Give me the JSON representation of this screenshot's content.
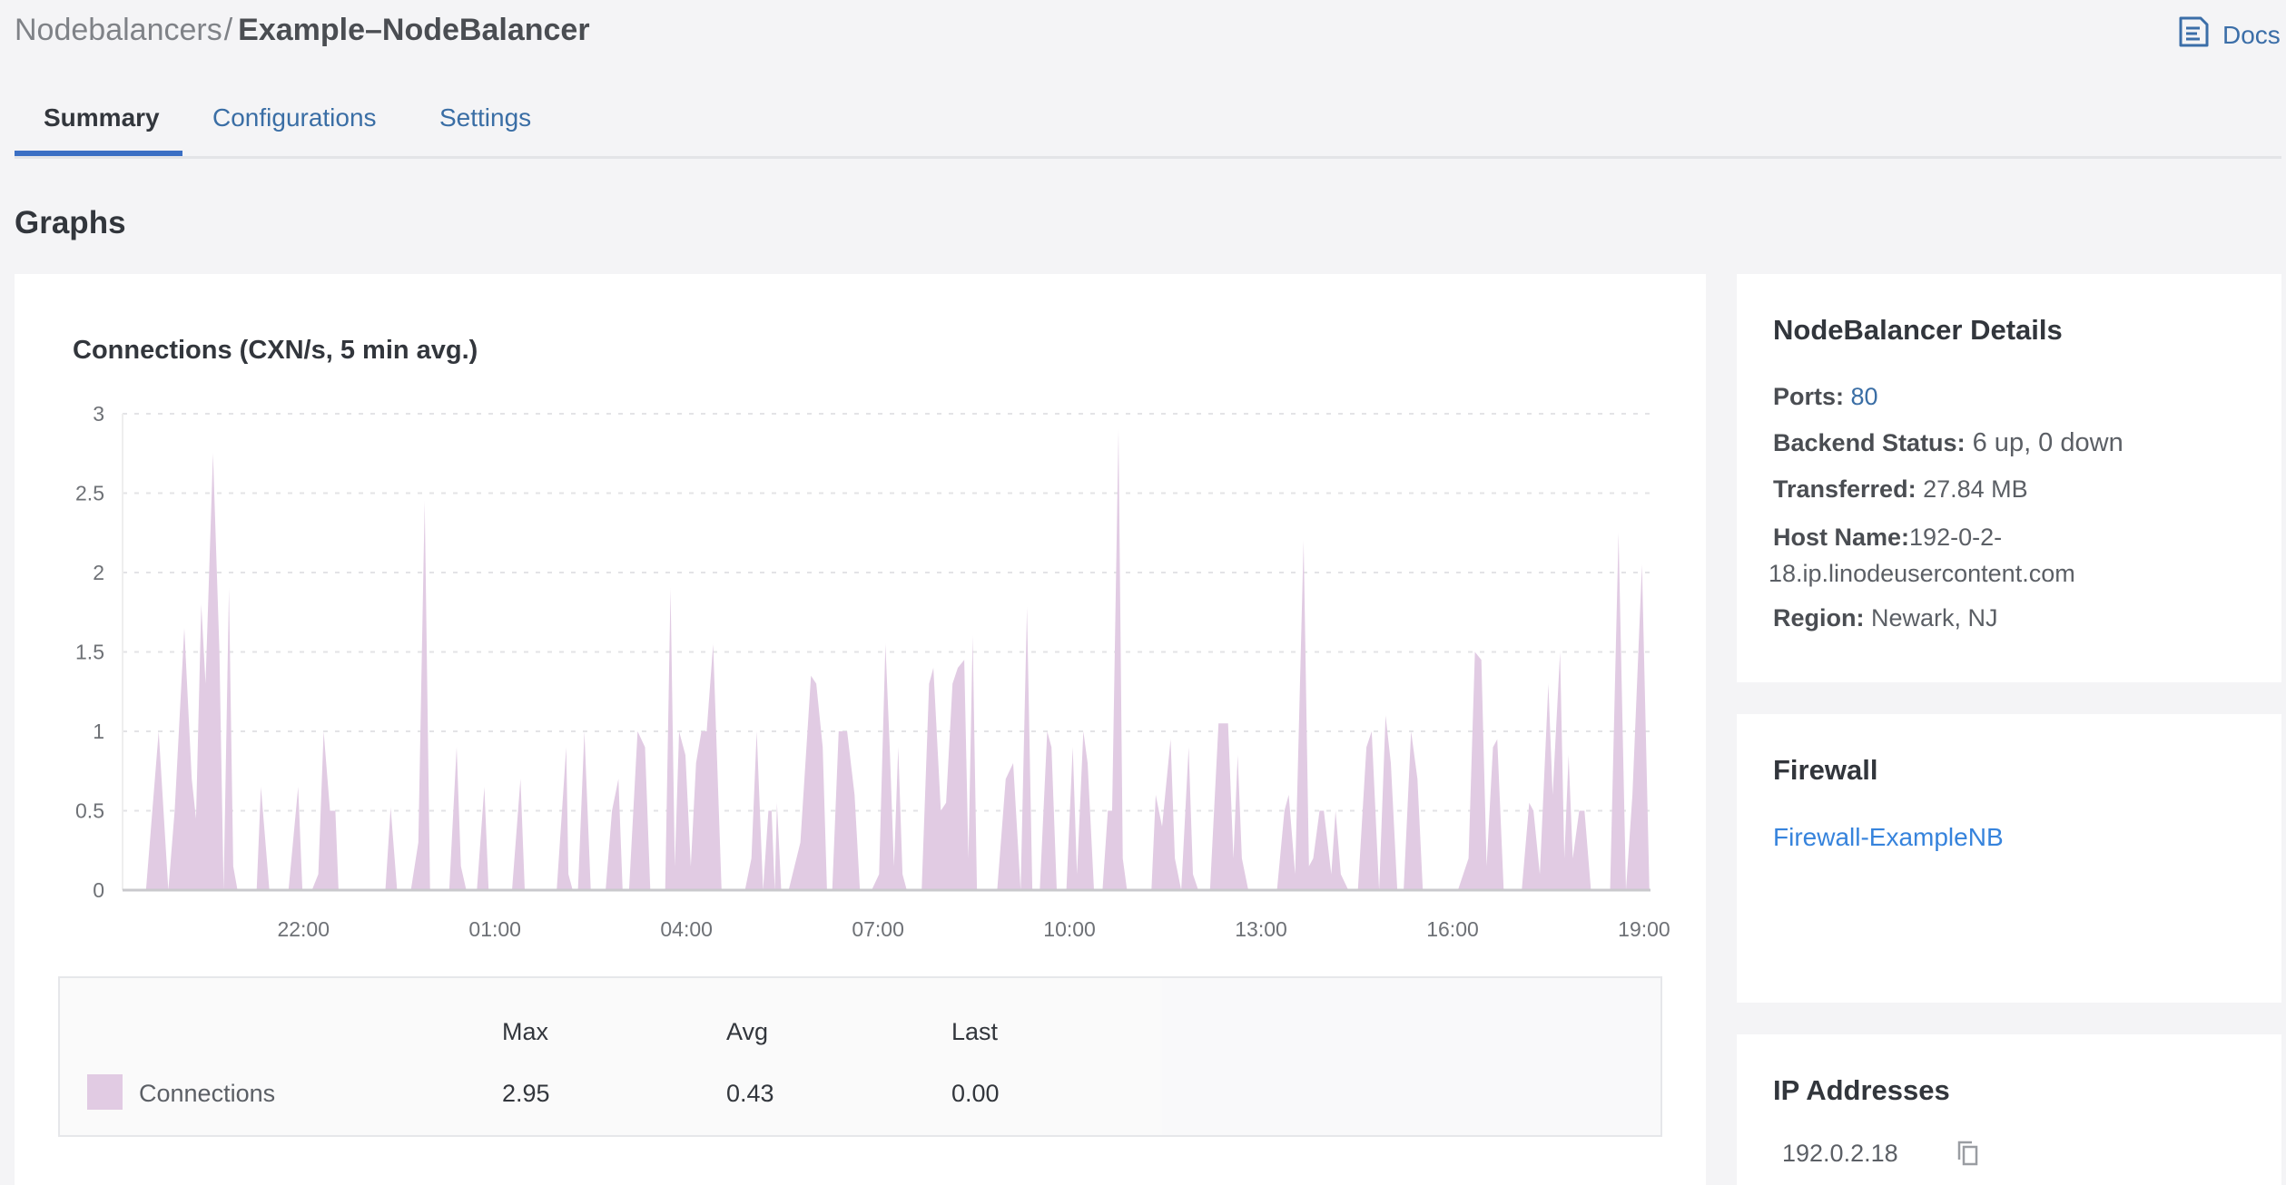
{
  "breadcrumb": {
    "parent": "Nodebalancers",
    "separator": "/",
    "current": "Example–NodeBalancer"
  },
  "docs": {
    "label": "Docs",
    "icon": "docs-icon"
  },
  "tabs": [
    {
      "label": "Summary",
      "active": true
    },
    {
      "label": "Configurations",
      "active": false
    },
    {
      "label": "Settings",
      "active": false
    }
  ],
  "section_title": "Graphs",
  "chart": {
    "title": "Connections (CXN/s, 5 min avg.)",
    "legend": {
      "headers": [
        "Max",
        "Avg",
        "Last"
      ],
      "rows": [
        {
          "name": "Connections",
          "max": "2.95",
          "avg": "0.43",
          "last": "0.00"
        }
      ]
    }
  },
  "chart_data": {
    "type": "area",
    "title": "Connections (CXN/s, 5 min avg.)",
    "xlabel": "",
    "ylabel": "",
    "xlim": [
      "19:10",
      "19:06"
    ],
    "ylim": [
      0,
      3
    ],
    "yticks": [
      "0",
      "0.5",
      "1",
      "1.5",
      "2",
      "2.5",
      "3"
    ],
    "xticks": [
      "22:00",
      "01:00",
      "04:00",
      "07:00",
      "10:00",
      "13:00",
      "16:00",
      "19:00"
    ],
    "grid": "horizontal dashed",
    "color": "#e1cbe3",
    "series": [
      {
        "name": "Connections",
        "points": [
          [
            "19:32",
            0
          ],
          [
            "19:44",
            1.0
          ],
          [
            "19:53",
            0
          ],
          [
            "19:59",
            0.5
          ],
          [
            "20:08",
            1.65
          ],
          [
            "20:15",
            0.7
          ],
          [
            "20:19",
            0.45
          ],
          [
            "20:24",
            1.8
          ],
          [
            "20:28",
            1.3
          ],
          [
            "20:35",
            2.75
          ],
          [
            "20:41",
            1.5
          ],
          [
            "20:45",
            0
          ],
          [
            "20:50",
            1.9
          ],
          [
            "20:54",
            0.15
          ],
          [
            "20:58",
            0
          ],
          [
            "21:16",
            0
          ],
          [
            "21:20",
            0.65
          ],
          [
            "21:28",
            0
          ],
          [
            "21:46",
            0
          ],
          [
            "21:55",
            0.65
          ],
          [
            "21:59",
            0
          ],
          [
            "22:08",
            0
          ],
          [
            "22:14",
            0.1
          ],
          [
            "22:19",
            1.0
          ],
          [
            "22:25",
            0.5
          ],
          [
            "22:30",
            0.5
          ],
          [
            "22:33",
            0
          ],
          [
            "23:17",
            0
          ],
          [
            "23:22",
            0.52
          ],
          [
            "23:28",
            0
          ],
          [
            "23:41",
            0
          ],
          [
            "23:48",
            0.3
          ],
          [
            "23:54",
            2.45
          ],
          [
            "23:59",
            0
          ],
          [
            "00:17",
            0
          ],
          [
            "00:24",
            0.9
          ],
          [
            "00:28",
            0.15
          ],
          [
            "00:33",
            0
          ],
          [
            "00:43",
            0
          ],
          [
            "00:50",
            0.65
          ],
          [
            "00:54",
            0
          ],
          [
            "01:16",
            0
          ],
          [
            "01:24",
            0.7
          ],
          [
            "01:28",
            0
          ],
          [
            "01:58",
            0
          ],
          [
            "02:07",
            0.9
          ],
          [
            "02:09",
            0.1
          ],
          [
            "02:13",
            0
          ],
          [
            "02:18",
            0
          ],
          [
            "02:24",
            1.0
          ],
          [
            "02:30",
            0
          ],
          [
            "02:44",
            0
          ],
          [
            "02:50",
            0.5
          ],
          [
            "02:56",
            0.7
          ],
          [
            "03:00",
            0
          ],
          [
            "03:06",
            0
          ],
          [
            "03:14",
            1.0
          ],
          [
            "03:21",
            0.9
          ],
          [
            "03:26",
            0
          ],
          [
            "03:40",
            0
          ],
          [
            "03:45",
            1.9
          ],
          [
            "03:49",
            0.15
          ],
          [
            "03:53",
            1.0
          ],
          [
            "03:59",
            0.85
          ],
          [
            "04:04",
            0.15
          ],
          [
            "04:09",
            0.8
          ],
          [
            "04:14",
            1.0
          ],
          [
            "04:19",
            1.0
          ],
          [
            "04:25",
            1.55
          ],
          [
            "04:33",
            0
          ],
          [
            "04:55",
            0
          ],
          [
            "05:01",
            0.2
          ],
          [
            "05:06",
            1.0
          ],
          [
            "05:12",
            0
          ],
          [
            "05:17",
            0.5
          ],
          [
            "05:20",
            0.5
          ],
          [
            "05:23",
            0
          ],
          [
            "05:25",
            0.55
          ],
          [
            "05:29",
            0
          ],
          [
            "05:36",
            0
          ],
          [
            "05:47",
            0.3
          ],
          [
            "05:57",
            1.35
          ],
          [
            "06:02",
            1.3
          ],
          [
            "06:08",
            0.9
          ],
          [
            "06:12",
            0
          ],
          [
            "06:17",
            0
          ],
          [
            "06:23",
            1.0
          ],
          [
            "06:31",
            1.0
          ],
          [
            "06:38",
            0.6
          ],
          [
            "06:43",
            0
          ],
          [
            "06:54",
            0
          ],
          [
            "07:01",
            0.1
          ],
          [
            "07:07",
            1.55
          ],
          [
            "07:11",
            0.9
          ],
          [
            "07:15",
            0.15
          ],
          [
            "07:19",
            0.9
          ],
          [
            "07:23",
            0.1
          ],
          [
            "07:27",
            0
          ],
          [
            "07:41",
            0
          ],
          [
            "07:48",
            1.3
          ],
          [
            "07:52",
            1.4
          ],
          [
            "07:59",
            0.5
          ],
          [
            "08:04",
            0.55
          ],
          [
            "08:10",
            1.3
          ],
          [
            "08:15",
            1.4
          ],
          [
            "08:21",
            1.45
          ],
          [
            "08:25",
            0.2
          ],
          [
            "08:29",
            1.6
          ],
          [
            "08:33",
            0
          ],
          [
            "08:52",
            0
          ],
          [
            "09:00",
            0.7
          ],
          [
            "09:07",
            0.8
          ],
          [
            "09:14",
            0
          ],
          [
            "09:20",
            1.78
          ],
          [
            "09:25",
            0
          ],
          [
            "09:32",
            0
          ],
          [
            "09:39",
            1.0
          ],
          [
            "09:43",
            0.9
          ],
          [
            "09:48",
            0
          ],
          [
            "09:57",
            0
          ],
          [
            "10:03",
            0.9
          ],
          [
            "10:07",
            0.1
          ],
          [
            "10:13",
            1.0
          ],
          [
            "10:17",
            0.8
          ],
          [
            "10:23",
            0
          ],
          [
            "10:31",
            0
          ],
          [
            "10:36",
            0.5
          ],
          [
            "10:40",
            0.5
          ],
          [
            "10:46",
            2.9
          ],
          [
            "10:50",
            0.2
          ],
          [
            "10:54",
            0
          ],
          [
            "11:13",
            0
          ],
          [
            "11:17",
            0
          ],
          [
            "11:21",
            0.6
          ],
          [
            "11:27",
            0.4
          ],
          [
            "11:35",
            0.95
          ],
          [
            "11:39",
            0.2
          ],
          [
            "11:45",
            0
          ],
          [
            "11:52",
            0.9
          ],
          [
            "11:56",
            0.1
          ],
          [
            "12:01",
            0
          ],
          [
            "12:12",
            0
          ],
          [
            "12:20",
            1.05
          ],
          [
            "12:29",
            1.05
          ],
          [
            "12:34",
            0.2
          ],
          [
            "12:38",
            0.85
          ],
          [
            "12:42",
            0.2
          ],
          [
            "12:48",
            0
          ],
          [
            "13:15",
            0
          ],
          [
            "13:22",
            0.5
          ],
          [
            "13:26",
            0.6
          ],
          [
            "13:32",
            0.1
          ],
          [
            "13:40",
            2.2
          ],
          [
            "13:45",
            0.15
          ],
          [
            "13:49",
            0.2
          ],
          [
            "13:55",
            0.5
          ],
          [
            "13:59",
            0.5
          ],
          [
            "14:06",
            0.1
          ],
          [
            "14:10",
            0.5
          ],
          [
            "14:15",
            0.1
          ],
          [
            "14:22",
            0
          ],
          [
            "14:31",
            0
          ],
          [
            "14:39",
            0.9
          ],
          [
            "14:44",
            1.0
          ],
          [
            "14:51",
            0
          ],
          [
            "14:57",
            1.1
          ],
          [
            "15:02",
            0.8
          ],
          [
            "15:08",
            0
          ],
          [
            "15:14",
            0
          ],
          [
            "15:21",
            1.0
          ],
          [
            "15:27",
            0.7
          ],
          [
            "15:32",
            0
          ],
          [
            "16:05",
            0
          ],
          [
            "16:15",
            0.2
          ],
          [
            "16:21",
            1.5
          ],
          [
            "16:27",
            1.45
          ],
          [
            "16:32",
            0.15
          ],
          [
            "16:38",
            0.9
          ],
          [
            "16:42",
            0.95
          ],
          [
            "16:48",
            0
          ],
          [
            "17:05",
            0
          ],
          [
            "17:12",
            0.55
          ],
          [
            "17:16",
            0.5
          ],
          [
            "17:22",
            0.1
          ],
          [
            "17:30",
            1.3
          ],
          [
            "17:34",
            0.6
          ],
          [
            "17:41",
            1.5
          ],
          [
            "17:45",
            0.2
          ],
          [
            "17:49",
            0.85
          ],
          [
            "17:53",
            0.2
          ],
          [
            "17:59",
            0.5
          ],
          [
            "18:04",
            0.5
          ],
          [
            "18:10",
            0
          ],
          [
            "18:28",
            0
          ],
          [
            "18:36",
            2.25
          ],
          [
            "18:43",
            0
          ],
          [
            "18:49",
            0.6
          ],
          [
            "18:58",
            2.05
          ],
          [
            "19:05",
            0
          ]
        ]
      }
    ]
  },
  "details": {
    "title": "NodeBalancer Details",
    "ports_label": "Ports:",
    "ports_value": "80",
    "backend_label": "Backend Status:",
    "backend_value": "6 up, 0 down",
    "transferred_label": "Transferred:",
    "transferred_value": "27.84 MB",
    "host_label": "Host Name:",
    "host_value_line1": "192-0-2-",
    "host_value_line2": "18.ip.linodeusercontent.com",
    "region_label": "Region:",
    "region_value": "Newark, NJ"
  },
  "firewall": {
    "title": "Firewall",
    "link": "Firewall-ExampleNB"
  },
  "ip_addresses": {
    "title": "IP Addresses",
    "items": [
      "192.0.2.18"
    ],
    "copy_icon": "copy-icon"
  }
}
